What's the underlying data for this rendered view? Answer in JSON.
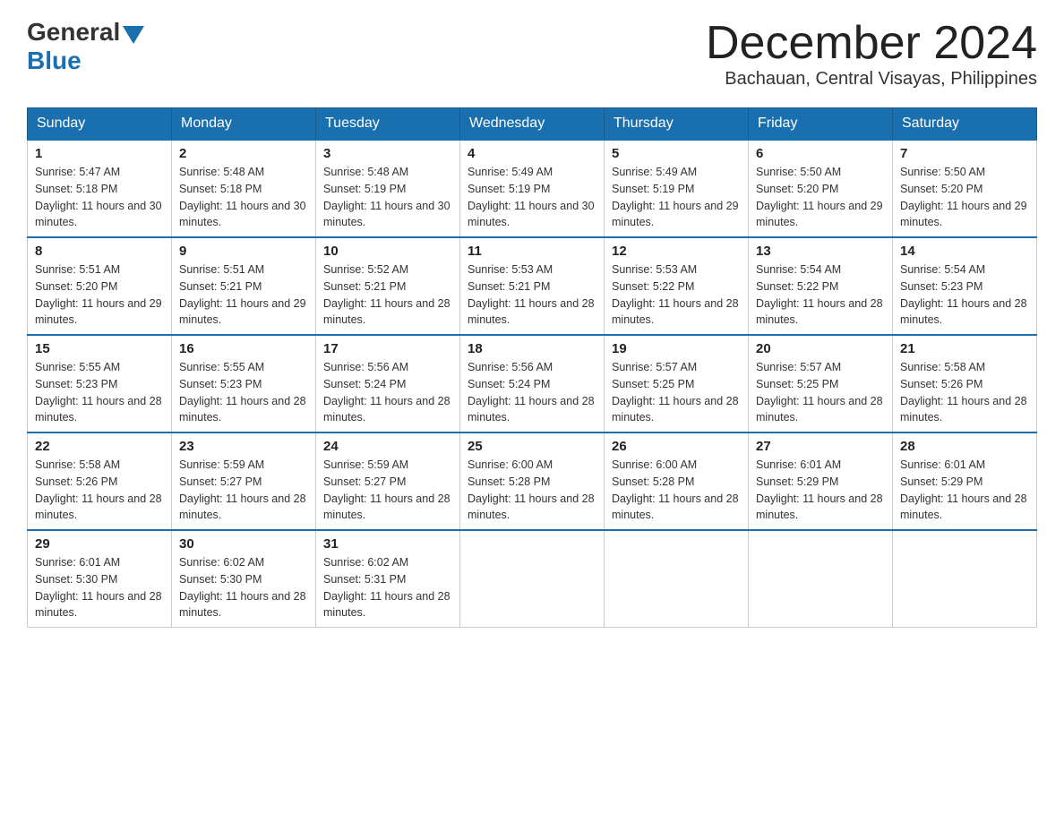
{
  "logo": {
    "general": "General",
    "blue": "Blue"
  },
  "header": {
    "month": "December 2024",
    "location": "Bachauan, Central Visayas, Philippines"
  },
  "days_of_week": [
    "Sunday",
    "Monday",
    "Tuesday",
    "Wednesday",
    "Thursday",
    "Friday",
    "Saturday"
  ],
  "weeks": [
    [
      {
        "day": "1",
        "sunrise": "5:47 AM",
        "sunset": "5:18 PM",
        "daylight": "11 hours and 30 minutes."
      },
      {
        "day": "2",
        "sunrise": "5:48 AM",
        "sunset": "5:18 PM",
        "daylight": "11 hours and 30 minutes."
      },
      {
        "day": "3",
        "sunrise": "5:48 AM",
        "sunset": "5:19 PM",
        "daylight": "11 hours and 30 minutes."
      },
      {
        "day": "4",
        "sunrise": "5:49 AM",
        "sunset": "5:19 PM",
        "daylight": "11 hours and 30 minutes."
      },
      {
        "day": "5",
        "sunrise": "5:49 AM",
        "sunset": "5:19 PM",
        "daylight": "11 hours and 29 minutes."
      },
      {
        "day": "6",
        "sunrise": "5:50 AM",
        "sunset": "5:20 PM",
        "daylight": "11 hours and 29 minutes."
      },
      {
        "day": "7",
        "sunrise": "5:50 AM",
        "sunset": "5:20 PM",
        "daylight": "11 hours and 29 minutes."
      }
    ],
    [
      {
        "day": "8",
        "sunrise": "5:51 AM",
        "sunset": "5:20 PM",
        "daylight": "11 hours and 29 minutes."
      },
      {
        "day": "9",
        "sunrise": "5:51 AM",
        "sunset": "5:21 PM",
        "daylight": "11 hours and 29 minutes."
      },
      {
        "day": "10",
        "sunrise": "5:52 AM",
        "sunset": "5:21 PM",
        "daylight": "11 hours and 28 minutes."
      },
      {
        "day": "11",
        "sunrise": "5:53 AM",
        "sunset": "5:21 PM",
        "daylight": "11 hours and 28 minutes."
      },
      {
        "day": "12",
        "sunrise": "5:53 AM",
        "sunset": "5:22 PM",
        "daylight": "11 hours and 28 minutes."
      },
      {
        "day": "13",
        "sunrise": "5:54 AM",
        "sunset": "5:22 PM",
        "daylight": "11 hours and 28 minutes."
      },
      {
        "day": "14",
        "sunrise": "5:54 AM",
        "sunset": "5:23 PM",
        "daylight": "11 hours and 28 minutes."
      }
    ],
    [
      {
        "day": "15",
        "sunrise": "5:55 AM",
        "sunset": "5:23 PM",
        "daylight": "11 hours and 28 minutes."
      },
      {
        "day": "16",
        "sunrise": "5:55 AM",
        "sunset": "5:23 PM",
        "daylight": "11 hours and 28 minutes."
      },
      {
        "day": "17",
        "sunrise": "5:56 AM",
        "sunset": "5:24 PM",
        "daylight": "11 hours and 28 minutes."
      },
      {
        "day": "18",
        "sunrise": "5:56 AM",
        "sunset": "5:24 PM",
        "daylight": "11 hours and 28 minutes."
      },
      {
        "day": "19",
        "sunrise": "5:57 AM",
        "sunset": "5:25 PM",
        "daylight": "11 hours and 28 minutes."
      },
      {
        "day": "20",
        "sunrise": "5:57 AM",
        "sunset": "5:25 PM",
        "daylight": "11 hours and 28 minutes."
      },
      {
        "day": "21",
        "sunrise": "5:58 AM",
        "sunset": "5:26 PM",
        "daylight": "11 hours and 28 minutes."
      }
    ],
    [
      {
        "day": "22",
        "sunrise": "5:58 AM",
        "sunset": "5:26 PM",
        "daylight": "11 hours and 28 minutes."
      },
      {
        "day": "23",
        "sunrise": "5:59 AM",
        "sunset": "5:27 PM",
        "daylight": "11 hours and 28 minutes."
      },
      {
        "day": "24",
        "sunrise": "5:59 AM",
        "sunset": "5:27 PM",
        "daylight": "11 hours and 28 minutes."
      },
      {
        "day": "25",
        "sunrise": "6:00 AM",
        "sunset": "5:28 PM",
        "daylight": "11 hours and 28 minutes."
      },
      {
        "day": "26",
        "sunrise": "6:00 AM",
        "sunset": "5:28 PM",
        "daylight": "11 hours and 28 minutes."
      },
      {
        "day": "27",
        "sunrise": "6:01 AM",
        "sunset": "5:29 PM",
        "daylight": "11 hours and 28 minutes."
      },
      {
        "day": "28",
        "sunrise": "6:01 AM",
        "sunset": "5:29 PM",
        "daylight": "11 hours and 28 minutes."
      }
    ],
    [
      {
        "day": "29",
        "sunrise": "6:01 AM",
        "sunset": "5:30 PM",
        "daylight": "11 hours and 28 minutes."
      },
      {
        "day": "30",
        "sunrise": "6:02 AM",
        "sunset": "5:30 PM",
        "daylight": "11 hours and 28 minutes."
      },
      {
        "day": "31",
        "sunrise": "6:02 AM",
        "sunset": "5:31 PM",
        "daylight": "11 hours and 28 minutes."
      },
      null,
      null,
      null,
      null
    ]
  ]
}
